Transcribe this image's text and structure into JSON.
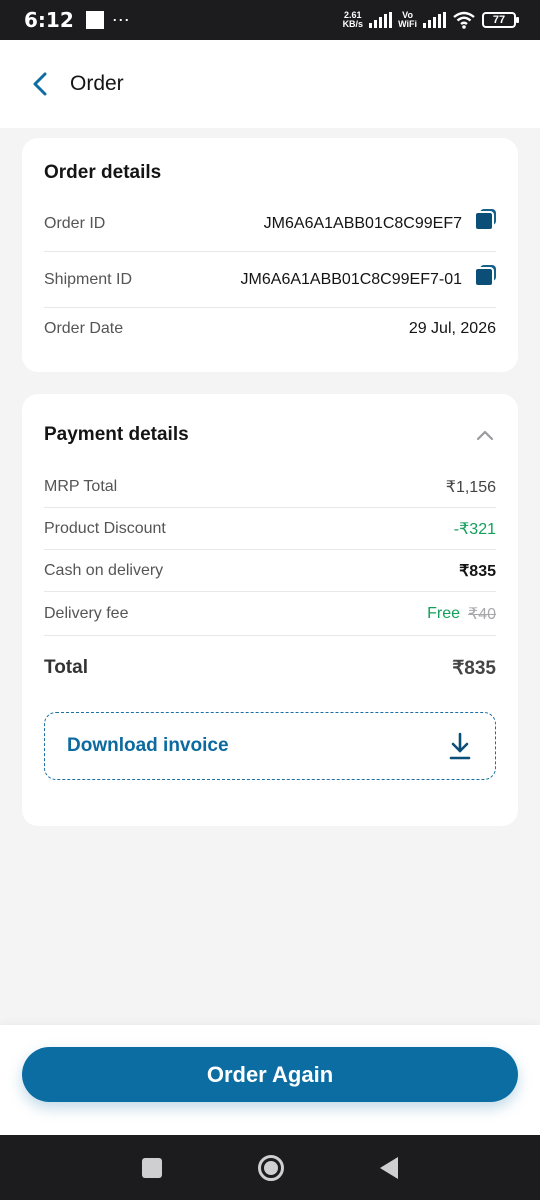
{
  "status_bar": {
    "time": "6:12",
    "dots": "⋯",
    "speed_value": "2.61",
    "speed_unit": "KB/s",
    "vo": "Vo",
    "wifi_label": "WiFi",
    "battery": "77"
  },
  "header": {
    "title": "Order"
  },
  "order_details": {
    "title": "Order details",
    "rows": [
      {
        "label": "Order ID",
        "value": "JM6A6A1ABB01C8C99EF7"
      },
      {
        "label": "Shipment ID",
        "value": "JM6A6A1ABB01C8C99EF7-01"
      },
      {
        "label": "Order Date",
        "value": "29 Jul, 2026"
      }
    ]
  },
  "payment_details": {
    "title": "Payment details",
    "mrp_total": {
      "label": "MRP Total",
      "value": "₹1,156"
    },
    "product_discount": {
      "label": "Product Discount",
      "value": "-₹321"
    },
    "cash_on_delivery": {
      "label": "Cash on delivery",
      "value": "₹835"
    },
    "delivery_fee": {
      "label": "Delivery fee",
      "value": "Free",
      "original": "₹40"
    },
    "total": {
      "label": "Total",
      "value": "₹835"
    },
    "download_invoice": "Download invoice"
  },
  "actions": {
    "order_again": "Order Again"
  },
  "colors": {
    "primary": "#0c6da3",
    "discount_green": "#12a05c",
    "background": "#f4f4f5"
  }
}
